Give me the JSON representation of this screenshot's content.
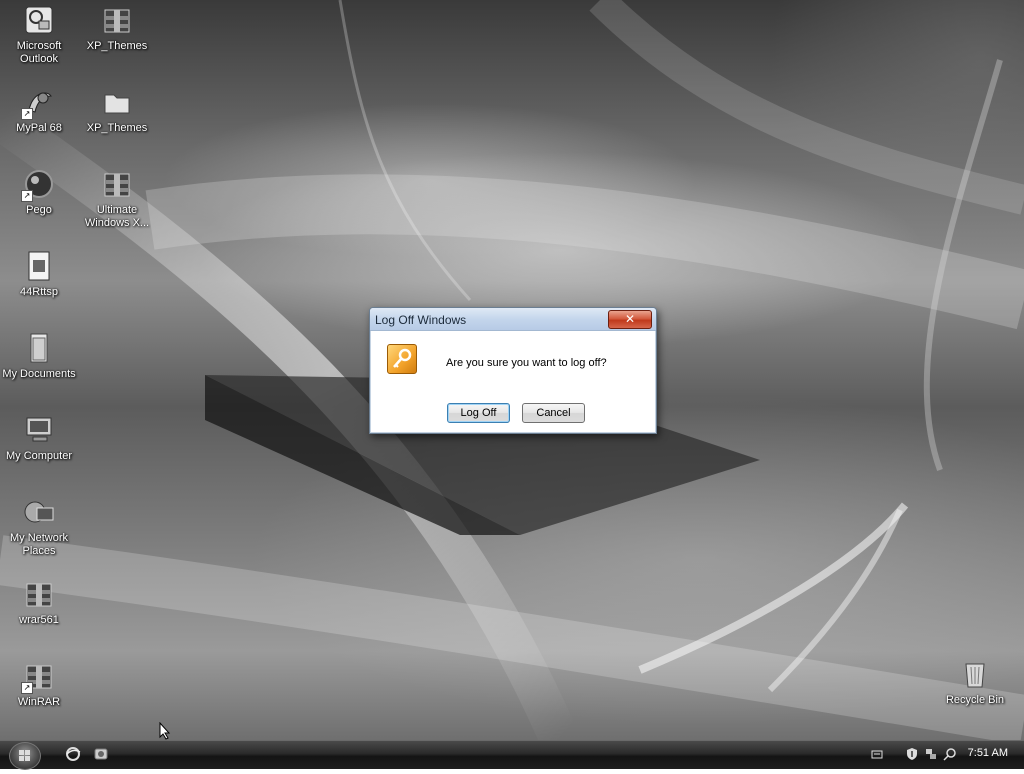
{
  "desktop_icons": [
    {
      "label": "Microsoft Outlook",
      "icon": "outlook-icon",
      "shortcut": false
    },
    {
      "label": "XP_Themes",
      "icon": "winrar-archive-icon",
      "shortcut": false
    },
    {
      "label": "MyPal 68",
      "icon": "mypal-browser-icon",
      "shortcut": true
    },
    {
      "label": "XP_Themes",
      "icon": "folder-icon",
      "shortcut": false
    },
    {
      "label": "Pego",
      "icon": "pego-icon",
      "shortcut": true
    },
    {
      "label": "Ultimate Windows X...",
      "icon": "winrar-archive-icon",
      "shortcut": false
    },
    {
      "label": "44Rttsp",
      "icon": "document-icon",
      "shortcut": false
    },
    {
      "label": "My Documents",
      "icon": "my-documents-icon",
      "shortcut": false
    },
    {
      "label": "My Computer",
      "icon": "computer-icon",
      "shortcut": false
    },
    {
      "label": "My Network Places",
      "icon": "network-icon",
      "shortcut": false
    },
    {
      "label": "wrar561",
      "icon": "winrar-installer-icon",
      "shortcut": false
    },
    {
      "label": "WinRAR",
      "icon": "winrar-icon",
      "shortcut": true
    },
    {
      "label": "Recycle Bin",
      "icon": "recycle-bin-icon",
      "shortcut": false
    }
  ],
  "dialog": {
    "title": "Log Off Windows",
    "close_label": "✕",
    "message": "Are you sure you want to log off?",
    "icon": "key-icon",
    "ok_label": "Log Off",
    "cancel_label": "Cancel"
  },
  "taskbar": {
    "start_button": "start-orb-icon",
    "quick_launch": [
      "internet-explorer-icon",
      "show-desktop-icon"
    ],
    "tray_icons": [
      "keyboard-icon",
      "security-shield-icon",
      "network-icon",
      "search-icon"
    ],
    "clock": "7:51 AM"
  }
}
